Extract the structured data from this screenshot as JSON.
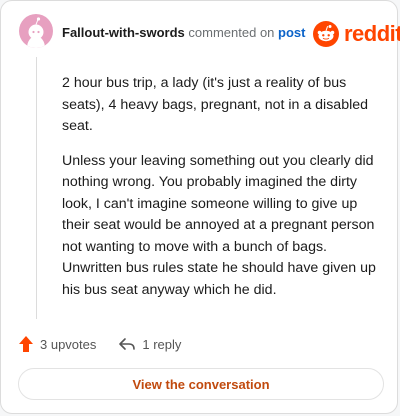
{
  "comment": {
    "author": "Fallout-with-swords",
    "action_text": "commented on",
    "link_text": "post",
    "paragraphs": [
      "2 hour bus trip, a lady (it's just a reality of bus seats), 4 heavy bags, pregnant, not in a disabled seat.",
      "Unless your leaving something out you clearly did nothing wrong. You probably imagined the dirty look, I can't imagine someone willing to give up their seat would be annoyed at a pregnant person not wanting to move with a bunch of bags. Unwritten bus rules state he should have given up his bus seat anyway which he did."
    ]
  },
  "brand": {
    "wordmark": "reddit",
    "color": "#ff4500",
    "icon": "reddit-alien-icon"
  },
  "actions": {
    "upvotes_label": "3 upvotes",
    "upvote_icon": "upvote-arrow-icon",
    "replies_label": "1 reply",
    "reply_icon": "reply-arrow-icon"
  },
  "cta": {
    "label": "View the conversation",
    "color": "#c14a0e"
  }
}
